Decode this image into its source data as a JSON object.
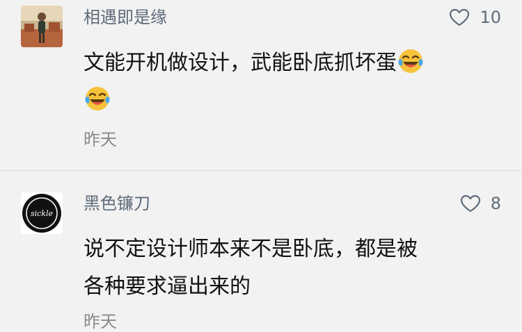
{
  "comments": [
    {
      "username": "相遇即是缘",
      "likes": "10",
      "text_part1": "文能开机做设计，武能卧底抓坏蛋",
      "emoji": "face-with-tears-of-joy",
      "time": "昨天"
    },
    {
      "username": "黑色镰刀",
      "likes": "8",
      "avatar_text": "sickle",
      "text_line1": "说不定设计师本来不是卧底，都是被",
      "text_line2": "各种要求逼出来的",
      "time": "昨天"
    }
  ],
  "colors": {
    "background": "#f2f2f2",
    "meta_text": "#5f6b7a",
    "body_text": "#111111"
  }
}
